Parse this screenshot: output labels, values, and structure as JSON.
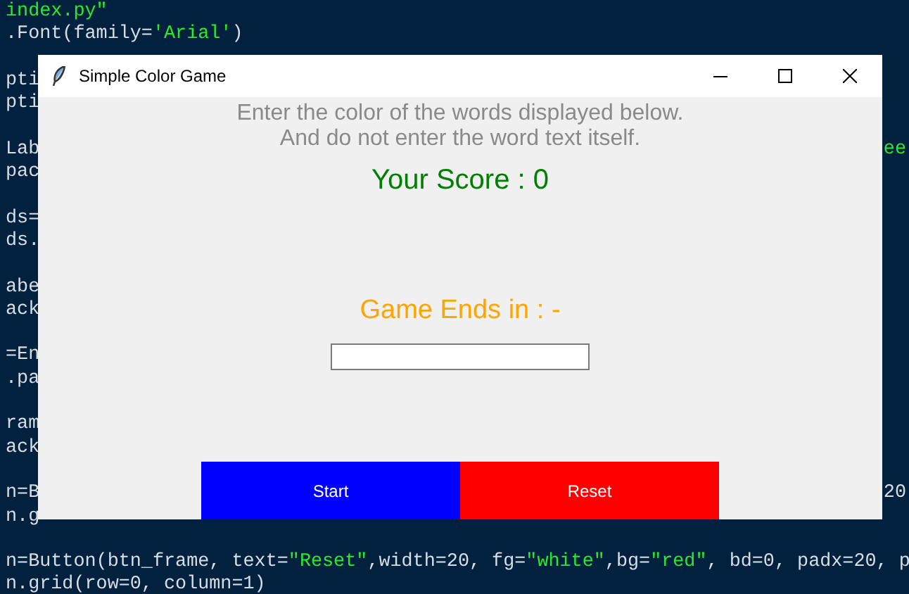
{
  "editor": {
    "blocks": [
      [
        {
          "segments": [
            {
              "text": "index.py\"",
              "kind": "string"
            }
          ]
        },
        {
          "segments": [
            {
              "text": ".Font(family=",
              "kind": "code"
            },
            {
              "text": "'Arial'",
              "kind": "string"
            },
            {
              "text": ")",
              "kind": "code"
            }
          ]
        }
      ],
      [
        {
          "segments": [
            {
              "text": "pti",
              "kind": "code"
            }
          ]
        },
        {
          "segments": [
            {
              "text": "pti",
              "kind": "code"
            }
          ]
        }
      ],
      [
        {
          "segments": [
            {
              "text": "Lab",
              "kind": "code"
            }
          ],
          "right": {
            "text": "ee",
            "kind": "string"
          }
        },
        {
          "segments": [
            {
              "text": "pac",
              "kind": "code"
            }
          ]
        }
      ],
      [
        {
          "segments": [
            {
              "text": "ds=",
              "kind": "code"
            }
          ]
        },
        {
          "segments": [
            {
              "text": "ds.",
              "kind": "code"
            }
          ]
        }
      ],
      [
        {
          "segments": [
            {
              "text": "abe",
              "kind": "code"
            }
          ]
        },
        {
          "segments": [
            {
              "text": "ack",
              "kind": "code"
            }
          ]
        }
      ],
      [
        {
          "segments": [
            {
              "text": "=En",
              "kind": "code"
            }
          ]
        },
        {
          "segments": [
            {
              "text": ".pa",
              "kind": "code"
            }
          ]
        }
      ],
      [
        {
          "segments": [
            {
              "text": "ram",
              "kind": "code"
            }
          ]
        },
        {
          "segments": [
            {
              "text": "ack",
              "kind": "code"
            }
          ]
        }
      ],
      [
        {
          "segments": [
            {
              "text": "n=B",
              "kind": "code"
            }
          ],
          "right": {
            "text": "20",
            "kind": "code"
          }
        },
        {
          "segments": [
            {
              "text": "n.g",
              "kind": "code"
            }
          ]
        }
      ],
      [
        {
          "segments": [
            {
              "text": "n=Button(btn_frame, text=",
              "kind": "code"
            },
            {
              "text": "\"Reset\"",
              "kind": "string"
            },
            {
              "text": ",width=20, fg=",
              "kind": "code"
            },
            {
              "text": "\"white\"",
              "kind": "string"
            },
            {
              "text": ",bg=",
              "kind": "code"
            },
            {
              "text": "\"red\"",
              "kind": "string"
            },
            {
              "text": ", bd=0, padx=20, p",
              "kind": "code"
            }
          ]
        },
        {
          "segments": [
            {
              "text": "n.grid(row=0, column=1)",
              "kind": "code"
            }
          ]
        }
      ]
    ]
  },
  "window": {
    "title": "Simple Color Game",
    "instructions": [
      "Enter the color of the words displayed below.",
      "And do not enter the word text itself."
    ],
    "score": "Your Score : 0",
    "timer": "Game Ends in : -",
    "buttons": [
      {
        "label": "Start",
        "color": "#0000ff"
      },
      {
        "label": "Reset",
        "color": "#ff0000"
      }
    ]
  }
}
